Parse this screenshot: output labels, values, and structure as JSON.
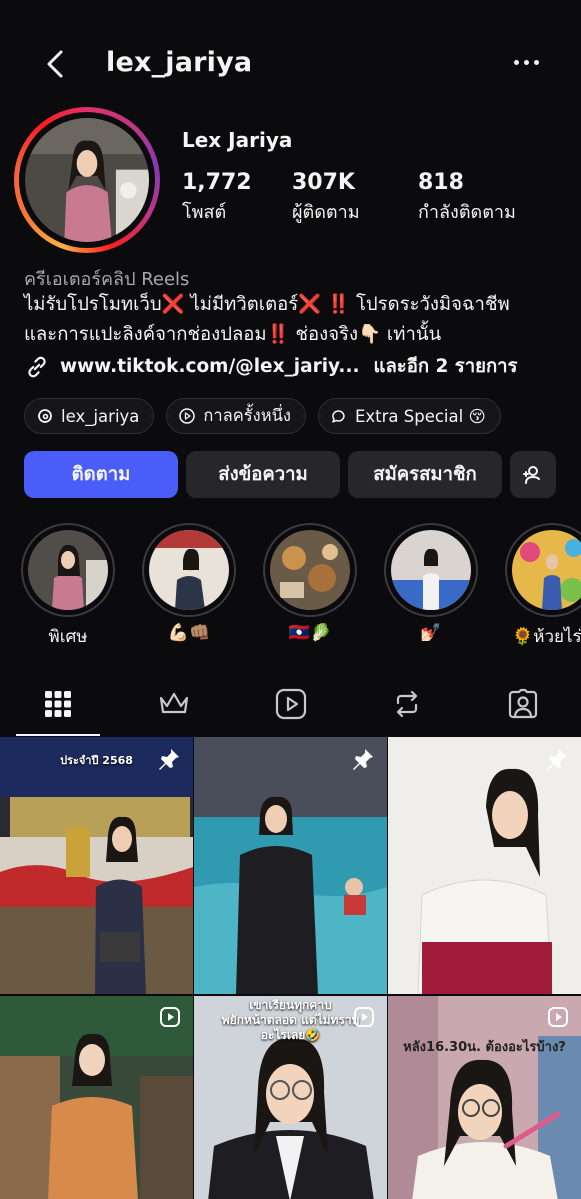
{
  "header": {
    "username": "lex_jariya"
  },
  "profile": {
    "display_name": "Lex Jariya",
    "stats": [
      {
        "value": "1,772",
        "label": "โพสต์"
      },
      {
        "value": "307K",
        "label": "ผู้ติดตาม"
      },
      {
        "value": "818",
        "label": "กำลังติดตาม"
      }
    ],
    "category": "ครีเอเตอร์คลิป Reels",
    "bio_line1": "ไม่รับโปรโมทเว็บ❌ ไม่มีทวิตเตอร์❌ ‼️ โปรดระวังมิจฉาชีพ",
    "bio_line2": "และการแปะลิงค์จากช่องปลอม‼️ ช่องจริง👇🏻 เท่านั้น",
    "link": "www.tiktok.com/@lex_jariy...",
    "more_links": "และอีก 2 รายการ"
  },
  "chips": [
    {
      "label": "lex_jariya",
      "icon": "threads-icon"
    },
    {
      "label": "กาลครั้งหนึ่ง",
      "icon": "play-icon"
    },
    {
      "label": "Extra Special 😚",
      "icon": "chat-icon"
    }
  ],
  "actions": {
    "follow": "ติดตาม",
    "message": "ส่งข้อความ",
    "subscribe": "สมัครสมาชิก"
  },
  "highlights": [
    {
      "label": "พิเศษ"
    },
    {
      "label": "💪🏻👊🏽"
    },
    {
      "label": "🇱🇦🥬"
    },
    {
      "label": "💅🏻"
    },
    {
      "label": "🌻ห้วยไร่อิ"
    }
  ],
  "tabs": [
    "grid-icon",
    "crown-icon",
    "reels-icon",
    "repost-icon",
    "tagged-icon"
  ],
  "grid_overlays": {
    "post1_line1": "ประจำปี 2568",
    "post5_line1": "เขาเรียนทุกคาบ",
    "post5_line2": "พยักหน้าตลอด แต่ไม่ทราบ",
    "post5_line3": "อะไรเลย🤣",
    "post6_line1": "หลัง16.30น. ต้องอะไรบ้าง?"
  },
  "colors": {
    "accent": "#4a5df9",
    "background": "#0b0b0d",
    "button": "#26262b"
  }
}
